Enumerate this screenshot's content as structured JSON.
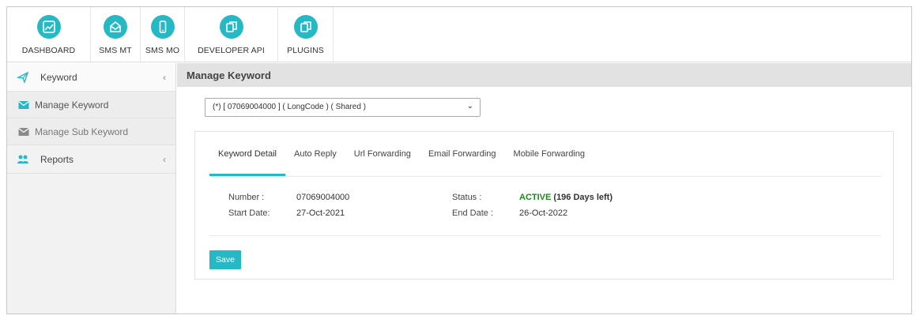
{
  "colors": {
    "accent": "#25b9c6",
    "active_status": "#1e8a1e",
    "header_bg": "#e2e2e2",
    "sidebar_bg": "#f2f2f2"
  },
  "topnav": {
    "items": [
      {
        "label": "DASHBOARD",
        "icon": "chart-line-icon"
      },
      {
        "label": "SMS MT",
        "icon": "envelope-open-icon"
      },
      {
        "label": "SMS MO",
        "icon": "mobile-phone-icon"
      },
      {
        "label": "DEVELOPER API",
        "icon": "copy-documents-icon"
      },
      {
        "label": "PLUGINS",
        "icon": "copy-documents-icon"
      }
    ]
  },
  "sidebar": {
    "keyword": {
      "label": "Keyword",
      "icon": "paper-plane-icon",
      "chevron": "‹"
    },
    "subitems": [
      {
        "label": "Manage Keyword",
        "icon": "envelope-icon"
      },
      {
        "label": "Manage Sub Keyword",
        "icon": "envelope-icon"
      }
    ],
    "reports": {
      "label": "Reports",
      "icon": "users-icon",
      "chevron": "‹"
    }
  },
  "main": {
    "title": "Manage Keyword",
    "select": {
      "value": "(*) [ 07069004000 ] ( LongCode ) ( Shared )",
      "arrow": "⌄"
    },
    "tabs": [
      "Keyword Detail",
      "Auto Reply",
      "Url Forwarding",
      "Email Forwarding",
      "Mobile Forwarding"
    ],
    "details": {
      "number_label": "Number :",
      "number_value": "07069004000",
      "start_label": "Start Date:",
      "start_value": "27-Oct-2021",
      "status_label": "Status :",
      "status_value": "ACTIVE",
      "status_days": " (196 Days left)",
      "end_label": "End Date :",
      "end_value": "26-Oct-2022"
    },
    "save_label": "Save"
  }
}
